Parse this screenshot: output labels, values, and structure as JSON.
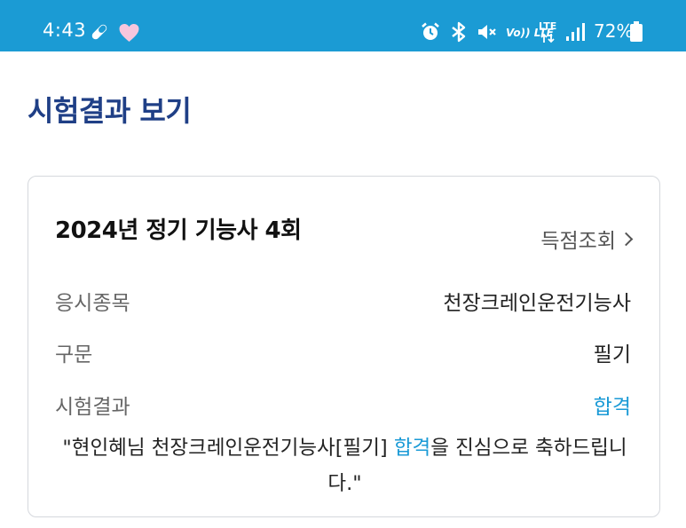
{
  "status_bar": {
    "time": "4:43",
    "battery_percent": "72%",
    "volte_label": "Vo)) LTE",
    "lte_label": "LTE",
    "icons": [
      "pill-icon",
      "heart-icon",
      "alarm-icon",
      "bluetooth-icon",
      "mute-icon",
      "volte-icon",
      "lte-icon",
      "signal-icon",
      "battery-icon"
    ]
  },
  "page": {
    "title": "시험결과 보기"
  },
  "result_card": {
    "exam_title": "2024년 정기 기능사 4회",
    "score_link_label": "득점조회",
    "rows": [
      {
        "label": "응시종목",
        "value": "천장크레인운전기능사"
      },
      {
        "label": "구문",
        "value": "필기"
      },
      {
        "label": "시험결과",
        "value": "합격"
      }
    ],
    "congrats": {
      "before": "\"현인혜님 천장크레인운전기능사[필기] ",
      "highlight": "합격",
      "after": "을 진심으로 축하드립니다.\""
    }
  },
  "colors": {
    "status_bar": "#1b9bd4",
    "title": "#1f3f86",
    "pass": "#1a9ad6"
  }
}
